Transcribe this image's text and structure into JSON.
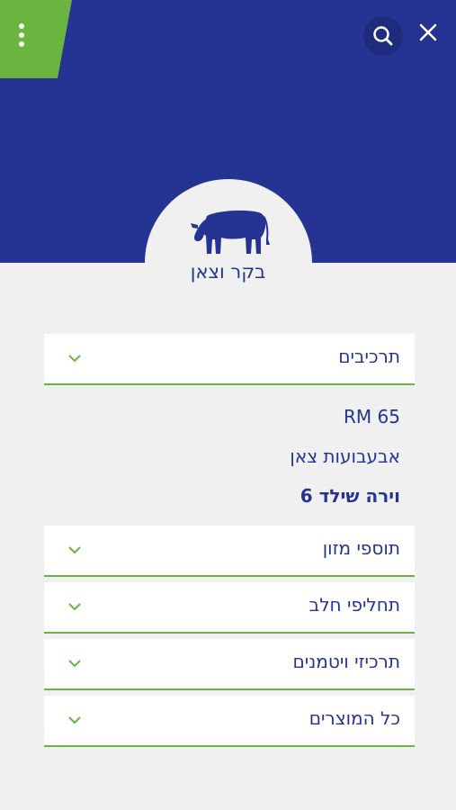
{
  "header": {
    "bg_color": "#253493",
    "accent_color": "#6ab43f",
    "menu_icon": "more-vertical-icon",
    "search_icon": "search-icon",
    "close_icon": "close-icon"
  },
  "category": {
    "icon": "cow-icon",
    "title": "בקר וצאן"
  },
  "accordion": [
    {
      "label": "תרכיבים",
      "expanded": true,
      "items": [
        {
          "label": "RM 65",
          "bold": false
        },
        {
          "label": "אבעבועות צאן",
          "bold": false
        },
        {
          "label": "וירה שילד 6",
          "bold": true
        }
      ]
    },
    {
      "label": "תוספי מזון",
      "expanded": false
    },
    {
      "label": "תחליפי חלב",
      "expanded": false
    },
    {
      "label": "תרכיזי ויטמנים",
      "expanded": false
    },
    {
      "label": "כל המוצרים",
      "expanded": false
    }
  ]
}
